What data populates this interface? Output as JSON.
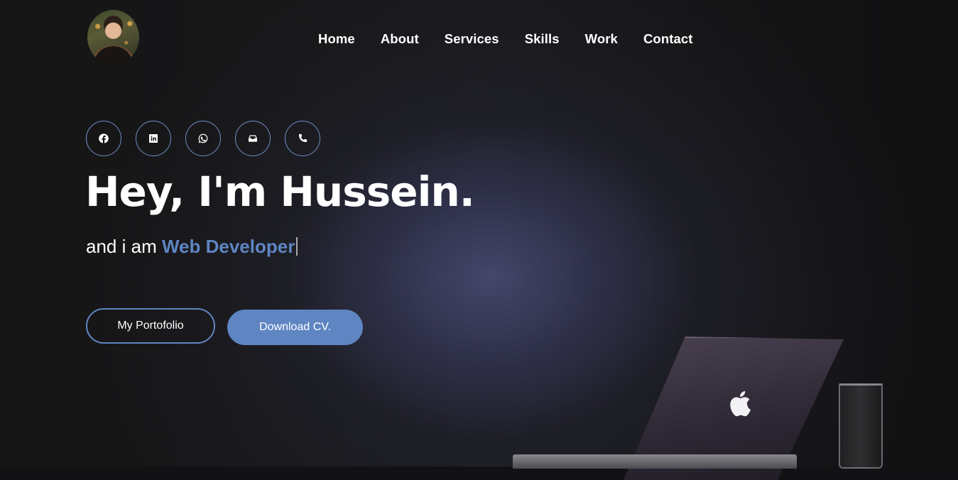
{
  "header": {
    "avatar_alt": "profile-avatar",
    "nav": [
      {
        "label": "Home"
      },
      {
        "label": "About"
      },
      {
        "label": "Services"
      },
      {
        "label": "Skills"
      },
      {
        "label": "Work"
      },
      {
        "label": "Contact"
      }
    ]
  },
  "socials": [
    {
      "icon": "facebook-icon"
    },
    {
      "icon": "linkedin-icon"
    },
    {
      "icon": "whatsapp-icon"
    },
    {
      "icon": "inbox-icon"
    },
    {
      "icon": "phone-icon"
    }
  ],
  "hero": {
    "title": "Hey, I'm Hussein.",
    "subtitle_prefix": "and i am ",
    "role": "Web Developer"
  },
  "buttons": {
    "portfolio": "My Portofolio",
    "download": "Download CV."
  },
  "colors": {
    "accent": "#5f85c2",
    "background": "#121214"
  }
}
